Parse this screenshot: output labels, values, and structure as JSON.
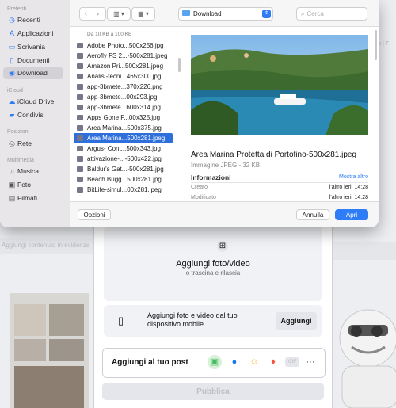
{
  "background": {
    "left_strip_text": "Aggiungi contenuto in evidenza",
    "right_strip_text": "ix | T",
    "composer": {
      "dropzone_title": "Aggiungi foto/video",
      "dropzone_subtitle": "o trascina e rilascia",
      "mobile_text": "Aggiungi foto e video dal tuo dispositivo mobile.",
      "mobile_button": "Aggiungi",
      "add_to_post_label": "Aggiungi al tuo post",
      "publish_button": "Pubblica"
    }
  },
  "dialog": {
    "sidebar": {
      "sections": [
        {
          "title": "Preferiti",
          "items": [
            {
              "label": "Recenti",
              "icon": "clock-icon"
            },
            {
              "label": "Applicazioni",
              "icon": "apps-icon"
            },
            {
              "label": "Scrivania",
              "icon": "desktop-icon"
            },
            {
              "label": "Documenti",
              "icon": "document-icon"
            },
            {
              "label": "Download",
              "icon": "download-icon",
              "active": true
            }
          ]
        },
        {
          "title": "iCloud",
          "items": [
            {
              "label": "iCloud Drive",
              "icon": "cloud-icon"
            },
            {
              "label": "Condivisi",
              "icon": "shared-folder-icon"
            }
          ]
        },
        {
          "title": "Posizioni",
          "items": [
            {
              "label": "Rete",
              "icon": "network-icon"
            }
          ]
        },
        {
          "title": "Multimedia",
          "items": [
            {
              "label": "Musica",
              "icon": "music-icon"
            },
            {
              "label": "Foto",
              "icon": "photo-icon"
            },
            {
              "label": "Filmati",
              "icon": "film-icon"
            }
          ]
        }
      ]
    },
    "toolbar": {
      "location": "Download",
      "search_placeholder": "Cerca"
    },
    "file_list": {
      "group_header": "Da 10 KB a 100 KB",
      "files": [
        "Adobe Photo...500x256.jpg",
        "Aerofly FS 2...-500x281.jpeg",
        "Amazon Pri...500x281.jpeg",
        "Analisi-tecni...465x300.jpg",
        "app-3bmete...370x226.png",
        "app-3bmete...00x293.jpg",
        "app-3bmete...600x314.jpg",
        "Apps Gone F...00x325.jpg",
        "Area Marina...500x375.jpg",
        "Area Marina...500x281.jpeg",
        "Argus- Cont...500x343.jpg",
        "attivazione-...-500x422.jpg",
        "Baldur's Gat...-500x281.jpg",
        "Beach Bugg...500x281.jpg",
        "BitLife-simul...00x281.jpeg"
      ],
      "selected_index": 9
    },
    "preview": {
      "title": "Area Marina Protetta di Portofino-500x281.jpeg",
      "subtitle": "Immagine JPEG - 32 KB",
      "info_heading": "Informazioni",
      "more_link": "Mostra altro",
      "rows": [
        {
          "key": "Creato",
          "value": "l'altro ieri, 14:28"
        },
        {
          "key": "Modificato",
          "value": "l'altro ieri, 14:28"
        }
      ]
    },
    "buttons": {
      "options": "Opzioni",
      "cancel": "Annulla",
      "open": "Apri"
    }
  }
}
